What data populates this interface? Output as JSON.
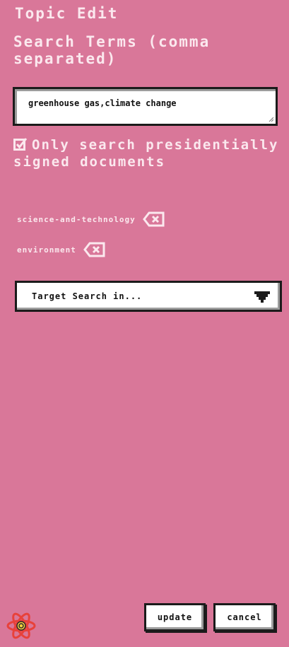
{
  "header": {
    "title": "Topic Edit"
  },
  "search_terms": {
    "label": "Search Terms (comma separated)",
    "value": "greenhouse gas,climate change"
  },
  "presidential_filter": {
    "checked": true,
    "label": "Only search presidentially signed documents"
  },
  "tags": [
    {
      "label": "science-and-technology",
      "remove_icon": "backspace-x-icon"
    },
    {
      "label": "environment",
      "remove_icon": "backspace-x-icon"
    }
  ],
  "target_select": {
    "selected": "Target Search in...",
    "arrow_icon": "triangle-down-icon"
  },
  "actions": {
    "update_label": "update",
    "cancel_label": "cancel"
  },
  "logo": {
    "icon": "atom-logo-icon"
  },
  "colors": {
    "background": "#d97799",
    "text": "#fbe8ee",
    "control_bg": "#ffffff",
    "control_border": "#1b1b1b",
    "logo_red": "#e8413a",
    "logo_yellow": "#f4d03f"
  }
}
